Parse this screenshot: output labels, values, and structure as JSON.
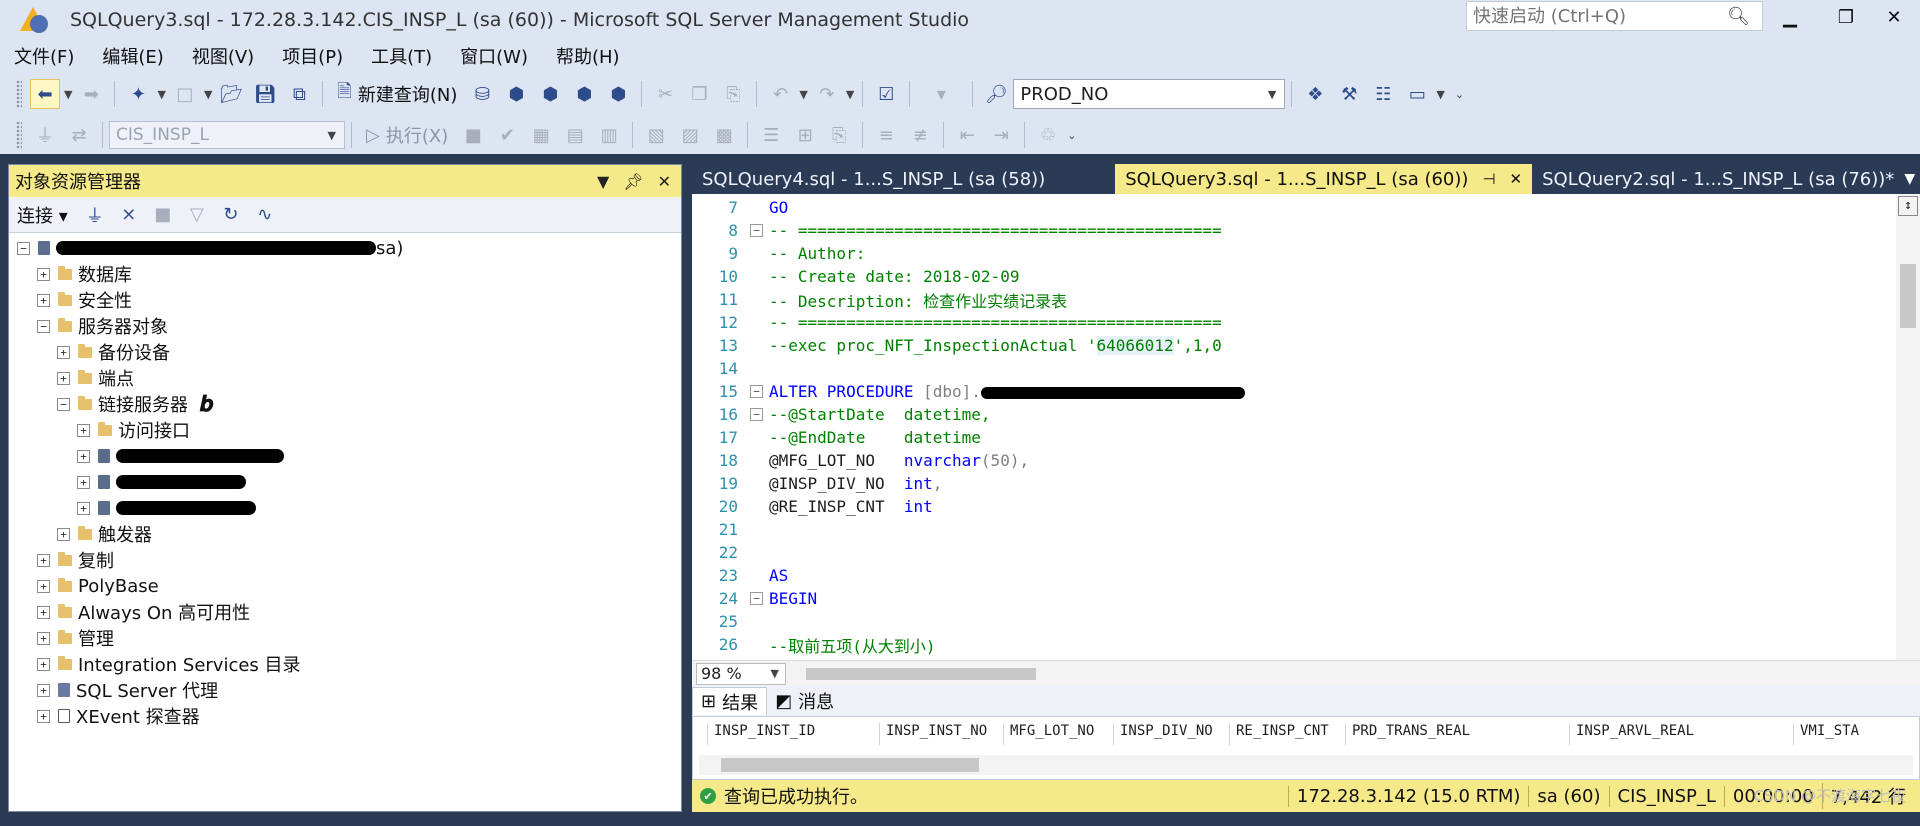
{
  "window": {
    "title": "SQLQuery3.sql - 172.28.3.142.CIS_INSP_L (sa (60)) - Microsoft SQL Server Management Studio",
    "quick_launch_placeholder": "快速启动 (Ctrl+Q)"
  },
  "menu": [
    "文件(F)",
    "编辑(E)",
    "视图(V)",
    "项目(P)",
    "工具(T)",
    "窗口(W)",
    "帮助(H)"
  ],
  "toolbar": {
    "new_query": "新建查询(N)",
    "solution_config": "PROD_NO",
    "database": "CIS_INSP_L",
    "execute": "执行(X)"
  },
  "object_explorer": {
    "title": "对象资源管理器",
    "connect": "连接",
    "root_suffix": "sa)",
    "nodes": {
      "databases": "数据库",
      "security": "安全性",
      "server_objects": "服务器对象",
      "backup_devices": "备份设备",
      "endpoints": "端点",
      "linked_servers": "链接服务器",
      "providers": "访问接口",
      "triggers": "触发器",
      "replication": "复制",
      "polybase": "PolyBase",
      "always_on": "Always On 高可用性",
      "management": "管理",
      "integration_services": "Integration Services 目录",
      "sql_agent": "SQL Server 代理",
      "xevent": "XEvent 探查器"
    }
  },
  "tabs": [
    {
      "label": "SQLQuery4.sql - 1...S_INSP_L (sa (58))"
    },
    {
      "label": "SQLQuery3.sql - 1...S_INSP_L (sa (60))"
    },
    {
      "label": "SQLQuery2.sql - 1...S_INSP_L (sa (76))*"
    }
  ],
  "editor": {
    "lines": [
      {
        "n": "7",
        "t": "GO"
      },
      {
        "n": "8",
        "t": "-- ============================================"
      },
      {
        "n": "9",
        "t": "-- Author:"
      },
      {
        "n": "10",
        "t": "-- Create date: 2018-02-09"
      },
      {
        "n": "11",
        "t": "-- Description: 检查作业实绩记录表"
      },
      {
        "n": "12",
        "t": "-- ============================================"
      },
      {
        "n": "13",
        "t1": "--exec proc_NFT_InspectionActual '",
        "t2": "64066012",
        "t3": "',1,0"
      },
      {
        "n": "14",
        "t": ""
      },
      {
        "n": "15",
        "kw": "ALTER PROCEDURE ",
        "t": "[dbo]."
      },
      {
        "n": "16",
        "t": "--@StartDate  datetime,"
      },
      {
        "n": "17",
        "t": "--@EndDate    datetime"
      },
      {
        "n": "18",
        "p": "@MFG_LOT_NO   ",
        "ty": "nvarchar",
        "rest": "(50),"
      },
      {
        "n": "19",
        "p": "@INSP_DIV_NO  ",
        "ty": "int",
        "rest": ","
      },
      {
        "n": "20",
        "p": "@RE_INSP_CNT  ",
        "ty": "int",
        "rest": ""
      },
      {
        "n": "21",
        "t": ""
      },
      {
        "n": "22",
        "t": ""
      },
      {
        "n": "23",
        "t": "AS"
      },
      {
        "n": "24",
        "t": "BEGIN"
      },
      {
        "n": "25",
        "t": ""
      },
      {
        "n": "26",
        "t": "--取前五项(从大到小)"
      }
    ]
  },
  "zoom": "98 %",
  "results": {
    "tab_results": "结果",
    "tab_messages": "消息",
    "columns": [
      "INSP_INST_ID",
      "INSP_INST_NO",
      "MFG_LOT_NO",
      "INSP_DIV_NO",
      "RE_INSP_CNT",
      "PRD_TRANS_REAL",
      "INSP_ARVL_REAL",
      "VMI_STA"
    ]
  },
  "status": {
    "message": "查询已成功执行。",
    "server": "172.28.3.142 (15.0 RTM)",
    "user": "sa (60)",
    "db": "CIS_INSP_L",
    "time": "00:00:00",
    "rows": "7,442 行",
    "watermark": "CSDN @不渡海字七夜"
  },
  "colors": {
    "accent_tab": "#f6e989",
    "chrome": "#dde4f2",
    "frame": "#2b3a55"
  }
}
